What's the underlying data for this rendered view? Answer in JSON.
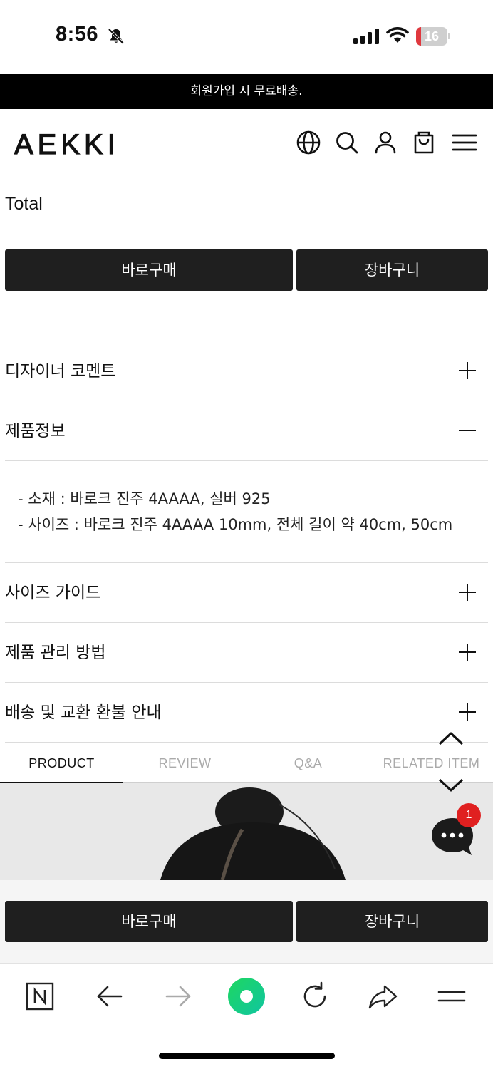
{
  "status_bar": {
    "time": "8:56",
    "battery": "16",
    "battery_level": 0.16
  },
  "promo": {
    "text": "회원가입 시 무료배송."
  },
  "header": {
    "logo": "AEKKI",
    "icons": [
      "globe-icon",
      "search-icon",
      "user-icon",
      "cart-icon",
      "menu-icon"
    ]
  },
  "total": {
    "label": "Total"
  },
  "top_buttons": {
    "buy_now": "바로구매",
    "cart": "장바구니"
  },
  "accordion": {
    "designer_comment": "디자이너 코멘트",
    "product_info": "제품정보",
    "size_guide": "사이즈 가이드",
    "care": "제품 관리 방법",
    "shipping": "배송 및 교환 환불 안내"
  },
  "product_info": {
    "lines": [
      "- 소재 : 바로크 진주 4AAAA, 실버 925",
      "- 사이즈 : 바로크 진주 4AAAA 10mm, 전체 길이 약 40cm, 50cm"
    ]
  },
  "tabs": [
    "PRODUCT",
    "REVIEW",
    "Q&A",
    "RELATED ITEM"
  ],
  "chat": {
    "badge": "1"
  },
  "bottom_buttons": {
    "buy_now": "바로구매",
    "cart": "장바구니"
  },
  "colors": {
    "accent_green": "#1ed760",
    "badge_red": "#e02020",
    "button_dark": "#1f1f1f"
  }
}
